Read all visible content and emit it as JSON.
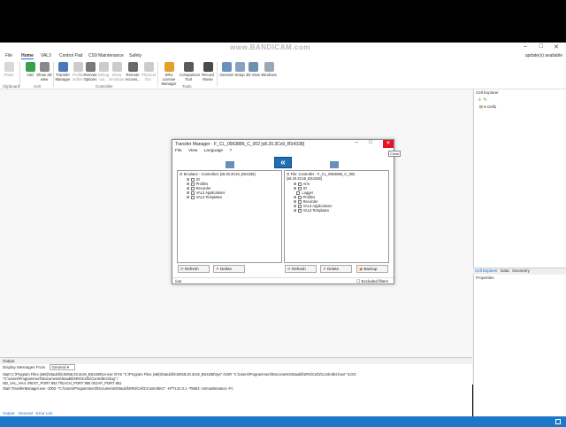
{
  "watermark": "www.BANDICAM.com",
  "menu": {
    "file": "File",
    "home": "Home",
    "val3": "VAL3",
    "control_pad": "Control Pad",
    "cs9_maintenance": "CS9 Maintenance",
    "safety": "Safety",
    "update": "update(s) available"
  },
  "ribbon": {
    "paste": "Paste",
    "add": "Add",
    "show3d": "Show 3D view",
    "transfer_manager": "Transfer Manager",
    "profile_editor": "Profile Editor",
    "remote_options": "Remote Options",
    "debug": "Debug var...",
    "show_emulator": "Show Emulator",
    "remote_access": "Remote Access...",
    "physical_em": "Physical Em.",
    "sru_license": "SRU License Manager",
    "comparison_tool": "Comparison Tool",
    "record_movie": "Record Movie",
    "general": "General",
    "setup": "Setup",
    "view3d": "3D View",
    "windows": "Windows",
    "groups": {
      "clipboard": "Clipboard",
      "cell": "Cell",
      "controller": "Controller",
      "tools": "Tools"
    }
  },
  "cell_explorer": {
    "title": "Cell Explorer",
    "tree_item": "Cell1"
  },
  "side_tabs": {
    "explorer": "Cell Explorer",
    "data": "Data",
    "geometry": "Geometry"
  },
  "properties": {
    "title": "Properties"
  },
  "output": {
    "title": "Output",
    "display_from": "Display Messages From",
    "source": "General",
    "log": [
      "Start C:\\Program Files (x86)\\Staubli\\CS8\\s8.20.3cs9_BS4338\\cs-exe  /SYS \"C:\\Program Files (x86)\\Staubli\\CS8\\s8.20.3cs9_BS4338\\sys\"  /USR \"C:\\Users\\Programmer3\\Documents\\Staubli\\SRS\\Cell1\\Controller1\\usr\"  /LOG \"C:\\Users\\Programmer3\\Documents\\Staubli\\SRS\\Cell1\\Controller1\\log\"  /",
      "ND_VAL_HA4.  /REST_PORT 852 /TEACH_PORT 850 /SOAP_PORT 851",
      "Start TransferManager.exe  -1003 -\"C:\\Users\\Programmer3\\Documents\\Staubli\\SRS\\Cell1\\Controller1\" -HTTL31 0.1 -T5653 -Unmaintenance -Fc"
    ],
    "tabs": [
      "Output",
      "General - Error List"
    ]
  },
  "dialog": {
    "title": "Transfer Manager - F_CL_0963886_C_002 [s8.20.3Cs9_BS4338]",
    "tooltip": "Close",
    "menu": [
      "File",
      "View",
      "Language",
      "?"
    ],
    "left": {
      "title": "Emulator - Controller1 [s8.20.3Cs9_BS4338]",
      "nodes": [
        "IO",
        "Profiles",
        "Recorder",
        "VAL3 Applications",
        "VAL3 Templates"
      ]
    },
    "right": {
      "title": "File: Controller - F_CL_0963886_C_002 [s8.20.3Cs9_BS4338]",
      "nodes": [
        "Arm",
        "IO",
        "Logger",
        "Profiles",
        "Recorder",
        "VAL3 Applications",
        "VAL3 Templates"
      ]
    },
    "buttons": {
      "refresh": "Refresh",
      "delete": "Delete",
      "backup": "Backup"
    },
    "status": "/usr",
    "excluded_filters": "Excluded filters"
  }
}
